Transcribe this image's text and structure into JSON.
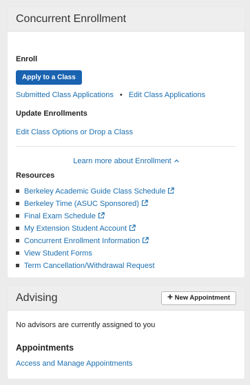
{
  "concurrent": {
    "title": "Concurrent Enrollment",
    "enroll_heading": "Enroll",
    "apply_button": "Apply to a Class",
    "submitted_link": "Submitted Class Applications",
    "separator": "•",
    "edit_applications_link": "Edit Class Applications",
    "update_heading": "Update Enrollments",
    "edit_options_link": "Edit Class Options or Drop a Class",
    "learn_more": "Learn more about Enrollment",
    "resources_heading": "Resources",
    "resources": [
      {
        "label": "Berkeley Academic Guide Class Schedule",
        "external": true
      },
      {
        "label": "Berkeley Time (ASUC Sponsored)",
        "external": true
      },
      {
        "label": "Final Exam Schedule",
        "external": true
      },
      {
        "label": "My Extension Student Account",
        "external": true
      },
      {
        "label": "Concurrent Enrollment Information",
        "external": true
      },
      {
        "label": "View Student Forms",
        "external": false
      },
      {
        "label": "Term Cancellation/Withdrawal Request",
        "external": false
      }
    ]
  },
  "advising": {
    "title": "Advising",
    "new_appointment_button": "New Appointment",
    "no_advisors_text": "No advisors are currently assigned to you",
    "appointments_heading": "Appointments",
    "manage_link": "Access and Manage Appointments"
  },
  "colors": {
    "link": "#1c6fb0",
    "primary_button": "#1963b0",
    "header_bg": "#eeeeee",
    "page_bg": "#ececec"
  },
  "icons": {
    "external_link": "external-link-icon",
    "chevron": "chevron-up-icon",
    "plus": "plus-icon",
    "bullet": "square-bullet"
  }
}
